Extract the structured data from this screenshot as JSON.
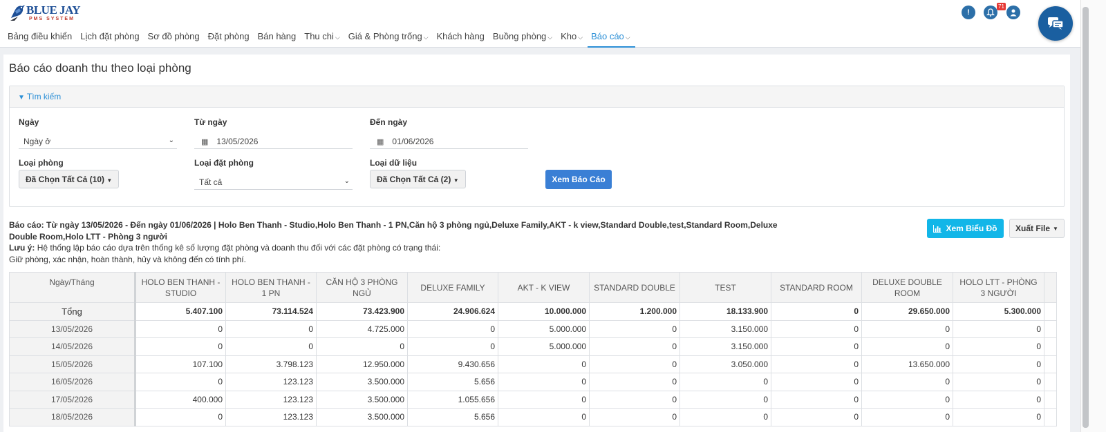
{
  "brand": {
    "name": "BLUE JAY",
    "tagline": "PMS SYSTEM"
  },
  "nav": [
    {
      "label": "Bảng điều khiển",
      "dropdown": false,
      "active": false
    },
    {
      "label": "Lịch đặt phòng",
      "dropdown": false,
      "active": false
    },
    {
      "label": "Sơ đồ phòng",
      "dropdown": false,
      "active": false
    },
    {
      "label": "Đặt phòng",
      "dropdown": false,
      "active": false
    },
    {
      "label": "Bán hàng",
      "dropdown": false,
      "active": false
    },
    {
      "label": "Thu chi",
      "dropdown": true,
      "active": false
    },
    {
      "label": "Giá & Phòng trống",
      "dropdown": true,
      "active": false
    },
    {
      "label": "Khách hàng",
      "dropdown": false,
      "active": false
    },
    {
      "label": "Buồng phòng",
      "dropdown": true,
      "active": false
    },
    {
      "label": "Kho",
      "dropdown": true,
      "active": false
    },
    {
      "label": "Báo cáo",
      "dropdown": true,
      "active": true
    }
  ],
  "header_icons": {
    "alert": "warning-icon",
    "notifications": "bell-icon",
    "notification_count": "71",
    "user": "user-icon",
    "chat": "chat-icon"
  },
  "page": {
    "title": "Báo cáo doanh thu theo loại phòng"
  },
  "search": {
    "header": "Tìm kiếm",
    "date_type": {
      "label": "Ngày",
      "value": "Ngày ở"
    },
    "from_date": {
      "label": "Từ ngày",
      "value": "13/05/2026"
    },
    "to_date": {
      "label": "Đến ngày",
      "value": "01/06/2026"
    },
    "room_type": {
      "label": "Loại phòng",
      "value": "Đã Chọn Tất Cả (10)"
    },
    "booking_type": {
      "label": "Loại đặt phòng",
      "value": "Tất cả"
    },
    "data_type": {
      "label": "Loại dữ liệu",
      "value": "Đã Chọn Tất Cả (2)"
    },
    "submit_label": "Xem Báo Cáo"
  },
  "report": {
    "summary": "Báo cáo: Từ ngày 13/05/2026 - Đến ngày 01/06/2026 | Holo Ben Thanh - Studio,Holo Ben Thanh - 1 PN,Căn hộ 3 phòng ngủ,Deluxe Family,AKT - k view,Standard Double,test,Standard Room,Deluxe Double Room,Holo LTT - Phòng 3 người",
    "note_label": "Lưu ý:",
    "note_line1": "Hệ thống lập báo cáo dựa trên thống kê số lượng đặt phòng và doanh thu đối với các đặt phòng có trạng thái:",
    "note_line2": "Giữ phòng, xác nhận, hoàn thành, hủy và không đến có tính phí.",
    "chart_button": "Xem Biểu Đồ",
    "export_button": "Xuất File"
  },
  "table": {
    "first_header": "Ngày/Tháng",
    "headers": [
      "HOLO BEN THANH - STUDIO",
      "HOLO BEN THANH - 1 PN",
      "CĂN HỘ 3 PHÒNG NGỦ",
      "DELUXE FAMILY",
      "AKT - K VIEW",
      "STANDARD DOUBLE",
      "TEST",
      "STANDARD ROOM",
      "DELUXE DOUBLE ROOM",
      "HOLO LTT - PHÒNG 3 NGƯỜI"
    ],
    "total": {
      "label": "Tổng",
      "values": [
        "5.407.100",
        "73.114.524",
        "73.423.900",
        "24.906.624",
        "10.000.000",
        "1.200.000",
        "18.133.900",
        "0",
        "29.650.000",
        "5.300.000"
      ]
    },
    "rows": [
      {
        "date": "13/05/2026",
        "values": [
          "0",
          "0",
          "4.725.000",
          "0",
          "5.000.000",
          "0",
          "3.150.000",
          "0",
          "0",
          "0"
        ]
      },
      {
        "date": "14/05/2026",
        "values": [
          "0",
          "0",
          "0",
          "0",
          "5.000.000",
          "0",
          "3.150.000",
          "0",
          "0",
          "0"
        ]
      },
      {
        "date": "15/05/2026",
        "values": [
          "107.100",
          "3.798.123",
          "12.950.000",
          "9.430.656",
          "0",
          "0",
          "3.050.000",
          "0",
          "13.650.000",
          "0"
        ]
      },
      {
        "date": "16/05/2026",
        "values": [
          "0",
          "123.123",
          "3.500.000",
          "5.656",
          "0",
          "0",
          "0",
          "0",
          "0",
          "0"
        ]
      },
      {
        "date": "17/05/2026",
        "values": [
          "400.000",
          "123.123",
          "3.500.000",
          "1.055.656",
          "0",
          "0",
          "0",
          "0",
          "0",
          "0"
        ]
      },
      {
        "date": "18/05/2026",
        "values": [
          "0",
          "123.123",
          "3.500.000",
          "5.656",
          "0",
          "0",
          "0",
          "0",
          "0",
          "0"
        ]
      }
    ]
  }
}
